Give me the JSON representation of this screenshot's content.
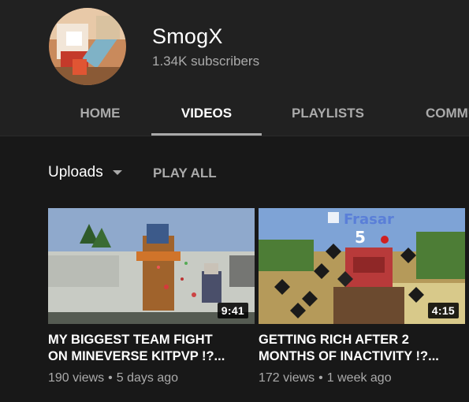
{
  "channel": {
    "name": "SmogX",
    "subscribers": "1.34K subscribers"
  },
  "tabs": [
    {
      "label": "HOME",
      "active": false
    },
    {
      "label": "VIDEOS",
      "active": true
    },
    {
      "label": "PLAYLISTS",
      "active": false
    },
    {
      "label": "COMMUNITY",
      "active": false
    }
  ],
  "uploads": {
    "label": "Uploads",
    "play_all": "PLAY ALL"
  },
  "videos": [
    {
      "title_line1": "MY BIGGEST TEAM FIGHT",
      "title_line2": "ON MINEVERSE KITPVP !?...",
      "duration": "9:41",
      "views": "190 views",
      "age": "5 days ago",
      "separator": "•"
    },
    {
      "title_line1": "GETTING RICH AFTER 2",
      "title_line2": "MONTHS OF INACTIVITY !?...",
      "duration": "4:15",
      "views": "172 views",
      "age": "1 week ago",
      "separator": "•",
      "thumbnail_overlay_text": "Frasar",
      "thumbnail_overlay_number": "5"
    }
  ],
  "colors": {
    "background": "#181818",
    "header_background": "#212121",
    "text_primary": "#ffffff",
    "text_secondary": "#aaaaaa"
  }
}
